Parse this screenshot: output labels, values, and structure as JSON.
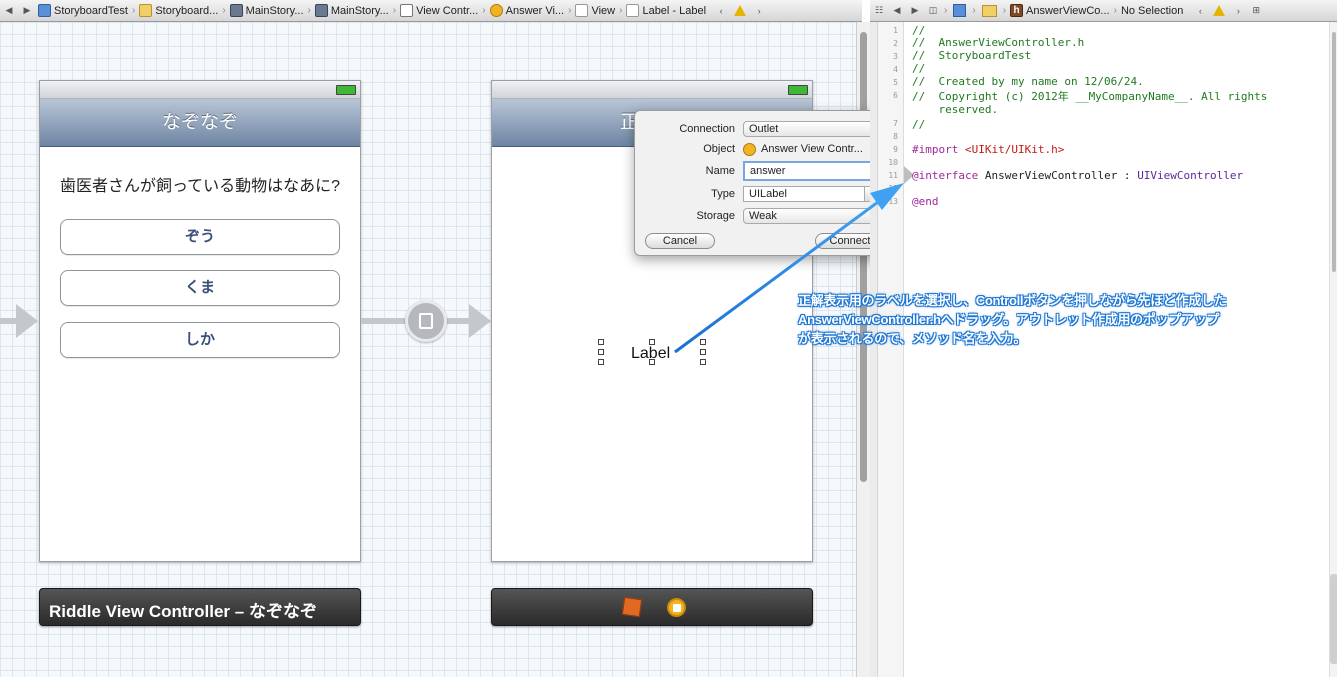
{
  "left_jumpbar": {
    "crumbs": [
      {
        "label": "StoryboardTest",
        "icon": "project-icon"
      },
      {
        "label": "Storyboard...",
        "icon": "folder-icon"
      },
      {
        "label": "MainStory...",
        "icon": "storyboard-icon"
      },
      {
        "label": "MainStory...",
        "icon": "storyboard-icon"
      },
      {
        "label": "View Contr...",
        "icon": "view-controller-icon"
      },
      {
        "label": "Answer Vi...",
        "icon": "object-icon"
      },
      {
        "label": "View",
        "icon": "view-icon"
      },
      {
        "label": "Label - Label",
        "icon": "label-icon"
      }
    ]
  },
  "right_jumpbar": {
    "file": "AnswerViewCo...",
    "selection": "No Selection"
  },
  "riddle_scene": {
    "title": "なぞなぞ",
    "question": "歯医者さんが飼っている動物はなあに?",
    "buttons": [
      "ぞう",
      "くま",
      "しか"
    ],
    "dock_label": "Riddle View Controller – なぞなぞ"
  },
  "answer_scene": {
    "title_partial": "正",
    "label_text": "Label"
  },
  "connection_popover": {
    "connection_label": "Connection",
    "connection_value": "Outlet",
    "object_label": "Object",
    "object_value": "Answer View Contr...",
    "name_label": "Name",
    "name_value": "answer",
    "type_label": "Type",
    "type_value": "UILabel",
    "storage_label": "Storage",
    "storage_value": "Weak",
    "cancel_button": "Cancel",
    "connect_button": "Connect"
  },
  "annotation": {
    "lines": [
      "正解表示用のラベルを選択し、Controllボタンを押しながら先ほど作成した",
      "AnswerViewController.hへドラッグ。アウトレット作成用のポップアップ",
      "が表示されるので、メソッド名を入力。"
    ],
    "color": "#1a74d2"
  },
  "code_editor": {
    "line_numbers": [
      "1",
      "2",
      "3",
      "4",
      "5",
      "6",
      "7",
      "8",
      "9",
      "10",
      "11",
      "12",
      "13"
    ],
    "comment_lines": [
      "//",
      "//  AnswerViewController.h",
      "//  StoryboardTest",
      "//",
      "//  Created by my name on 12/06/24.",
      "//  Copyright (c) 2012年 __MyCompanyName__. All rights",
      "    reserved.",
      "//"
    ],
    "import_directive": "#import",
    "import_file": "<UIKit/UIKit.h>",
    "interface_keyword": "@interface",
    "class_name": "AnswerViewController :",
    "superclass": "UIViewController",
    "end_keyword": "@end"
  }
}
